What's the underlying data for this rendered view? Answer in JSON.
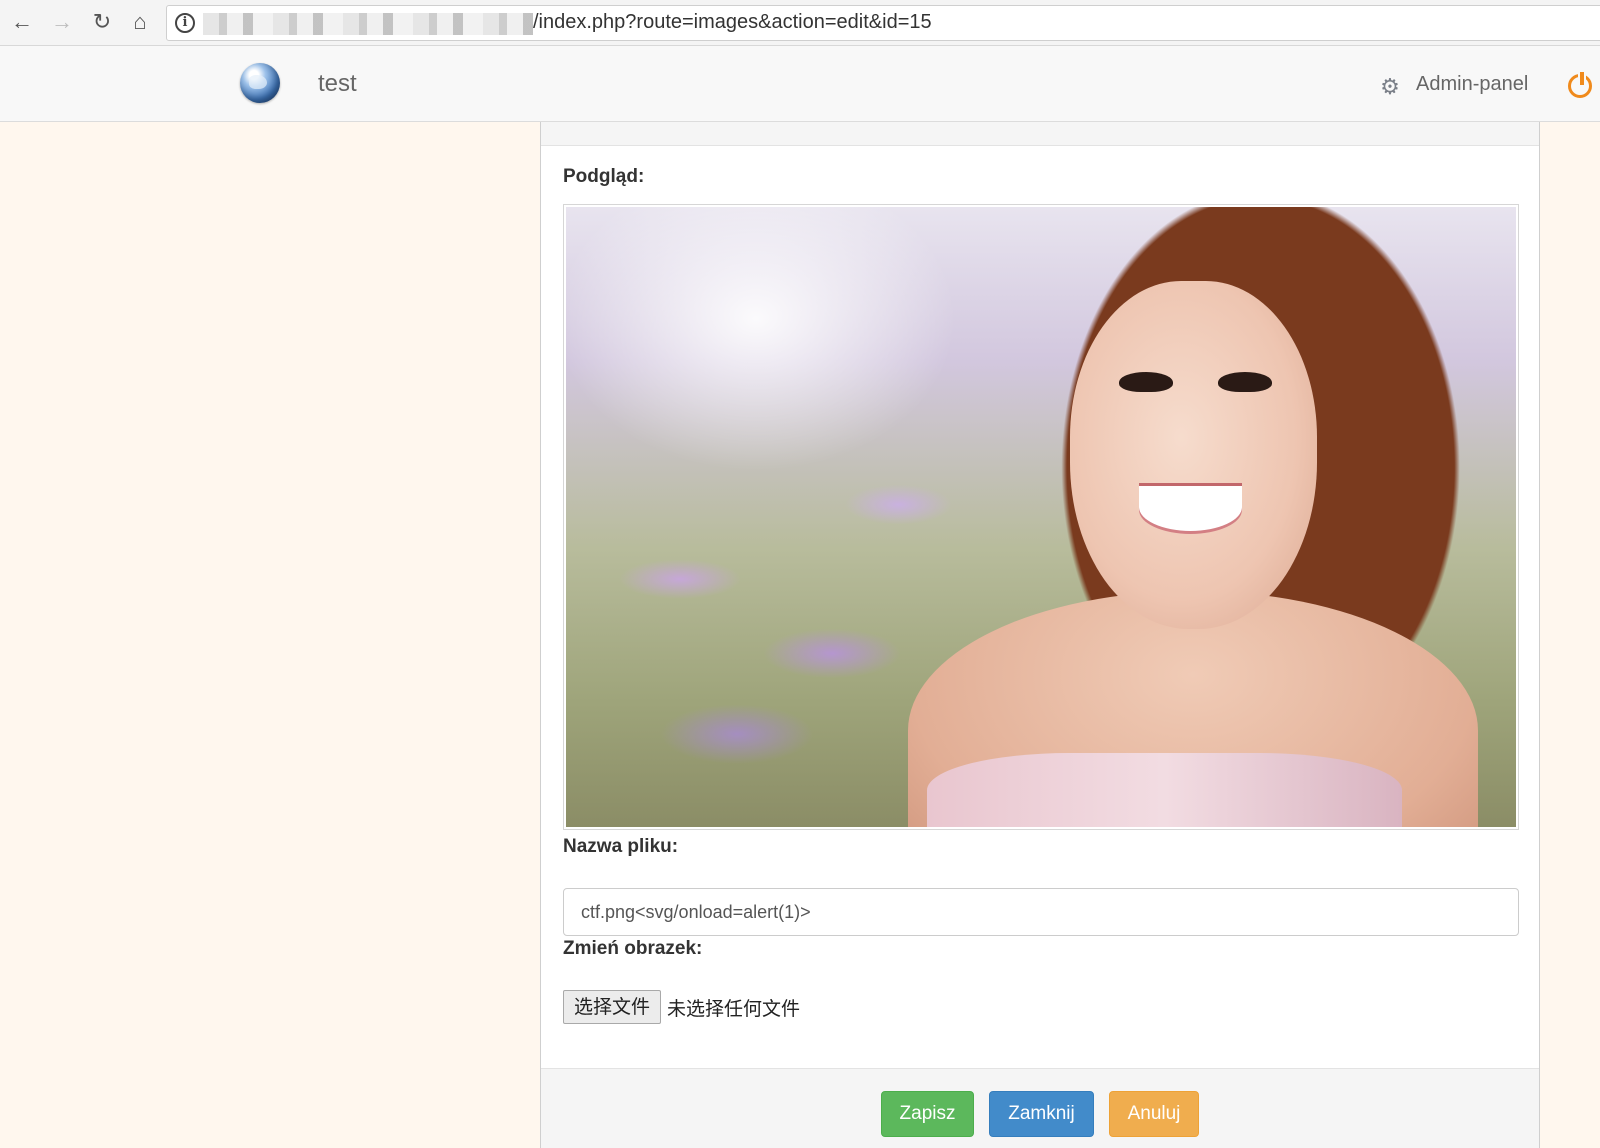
{
  "browser": {
    "url_visible": "/index.php?route=images&action=edit&id=15",
    "icons": [
      "back-arrow-icon",
      "forward-arrow-icon",
      "reload-icon",
      "home-icon",
      "info-icon"
    ]
  },
  "header": {
    "brand": "test",
    "admin_panel": "Admin-panel",
    "accent_color": "#f08a1c"
  },
  "form": {
    "preview_label": "Podgląd:",
    "filename_label": "Nazwa pliku:",
    "filename_value": "ctf.png<svg/onload=alert(1)>",
    "change_image_label": "Zmień obrazek:",
    "file_button": "选择文件",
    "file_status": "未选择任何文件"
  },
  "footer": {
    "save": "Zapisz",
    "close": "Zamknij",
    "cancel": "Anuluj",
    "colors": {
      "save": "#5cb85c",
      "close": "#428bca",
      "cancel": "#f0ad4e"
    }
  }
}
